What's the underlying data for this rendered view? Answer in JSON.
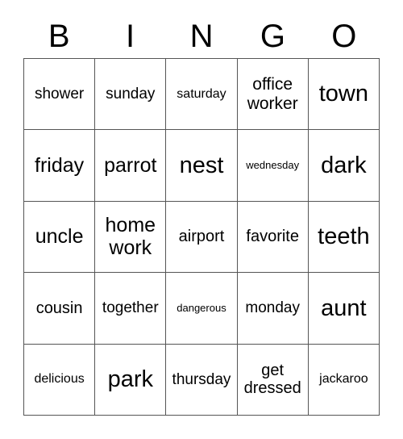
{
  "card": {
    "title": "BINGO",
    "header_letters": [
      "B",
      "I",
      "N",
      "G",
      "O"
    ],
    "grid_line_color": "#555555",
    "background_color": "#ffffff",
    "text_color": "#000000",
    "rows": [
      [
        {
          "text": "shower",
          "size": "m"
        },
        {
          "text": "sunday",
          "size": "m"
        },
        {
          "text": "saturday",
          "size": "s"
        },
        {
          "text": "office worker",
          "size": "l"
        },
        {
          "text": "town",
          "size": "xxl"
        }
      ],
      [
        {
          "text": "friday",
          "size": "xl"
        },
        {
          "text": "parrot",
          "size": "xl"
        },
        {
          "text": "nest",
          "size": "xxl"
        },
        {
          "text": "wednesday",
          "size": "xs"
        },
        {
          "text": "dark",
          "size": "xxl"
        }
      ],
      [
        {
          "text": "uncle",
          "size": "xl"
        },
        {
          "text": "home work",
          "size": "xl"
        },
        {
          "text": "airport",
          "size": "ml"
        },
        {
          "text": "favorite",
          "size": "ml"
        },
        {
          "text": "teeth",
          "size": "xxl"
        }
      ],
      [
        {
          "text": "cousin",
          "size": "ml"
        },
        {
          "text": "together",
          "size": "m"
        },
        {
          "text": "dangerous",
          "size": "xs"
        },
        {
          "text": "monday",
          "size": "m"
        },
        {
          "text": "aunt",
          "size": "xxl"
        }
      ],
      [
        {
          "text": "delicious",
          "size": "s"
        },
        {
          "text": "park",
          "size": "xxl"
        },
        {
          "text": "thursday",
          "size": "m"
        },
        {
          "text": "get dressed",
          "size": "ml"
        },
        {
          "text": "jackaroo",
          "size": "s"
        }
      ]
    ]
  }
}
